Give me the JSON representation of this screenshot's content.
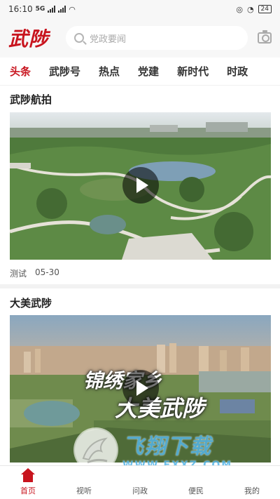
{
  "status_bar": {
    "time": "16:10",
    "network": "5G",
    "battery": "24"
  },
  "header": {
    "logo": "武陟",
    "search_placeholder": "党政要闻"
  },
  "tabs": [
    {
      "label": "头条",
      "active": true
    },
    {
      "label": "武陟号",
      "active": false
    },
    {
      "label": "热点",
      "active": false
    },
    {
      "label": "党建",
      "active": false
    },
    {
      "label": "新时代",
      "active": false
    },
    {
      "label": "时政",
      "active": false
    }
  ],
  "feed": [
    {
      "title": "武陟航拍",
      "source": "测试",
      "date": "05-30"
    },
    {
      "title": "大美武陟",
      "overlay_line1": "锦绣家乡",
      "overlay_line2": "大美武陟"
    }
  ],
  "watermark": {
    "name": "飞翔下载",
    "url": "WWW.FXXZ.COM"
  },
  "bottom_nav": [
    {
      "label": "首页",
      "icon": "home-icon",
      "active": true
    },
    {
      "label": "视听",
      "icon": "video-icon",
      "active": false
    },
    {
      "label": "问政",
      "icon": "question-icon",
      "active": false
    },
    {
      "label": "便民",
      "icon": "service-icon",
      "active": false
    },
    {
      "label": "我的",
      "icon": "user-icon",
      "active": false
    }
  ],
  "colors": {
    "brand_red": "#c8141e",
    "watermark_blue": "#56b6e8"
  }
}
